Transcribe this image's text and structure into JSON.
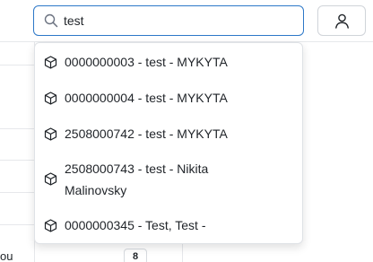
{
  "search": {
    "value": "test",
    "icon": "search-icon"
  },
  "header": {
    "user_icon": "user-icon"
  },
  "results": [
    {
      "label": "0000000003 - test - MYKYTA",
      "icon": "package-icon"
    },
    {
      "label": "0000000004 - test - MYKYTA",
      "icon": "package-icon"
    },
    {
      "label": "2508000742 - test - MYKYTA",
      "icon": "package-icon"
    },
    {
      "label": "2508000743 - test - Nikita Malinovsky",
      "icon": "package-icon"
    },
    {
      "label": "0000000345 - Test, Test -",
      "icon": "package-icon"
    }
  ],
  "background": {
    "row_text": "ou",
    "row_count": "8"
  }
}
